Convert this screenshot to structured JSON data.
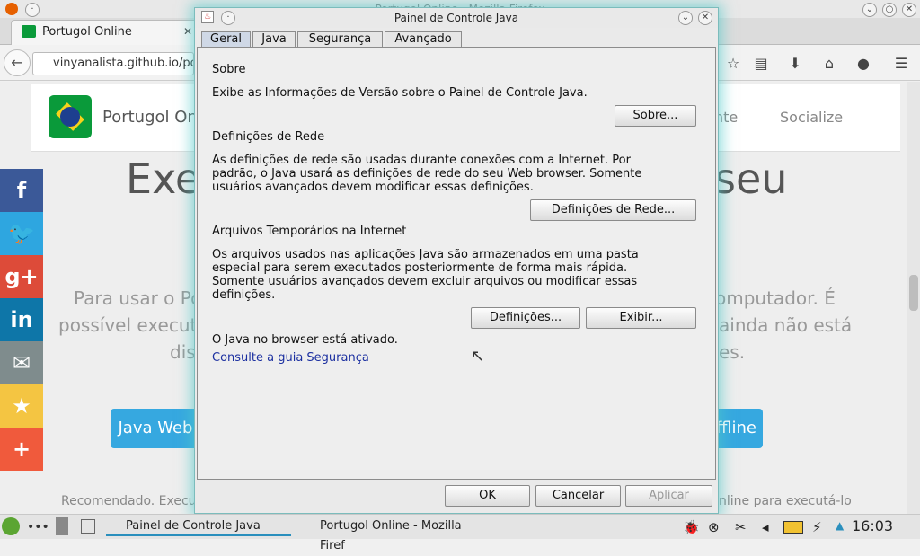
{
  "browser": {
    "window_title": "Portugol Online - Mozilla Firefox",
    "tab_title": "Portugol Online",
    "url": "vinyanalista.github.io/por"
  },
  "site": {
    "title": "Portugol Onli",
    "nav_right": "nte",
    "socialize": "Socialize",
    "hero_left": "Exe",
    "hero_right": "seu",
    "para_l1": "Para usar o Po",
    "para_l2": "possível execut",
    "para_l3": "dis",
    "para_r1": "omputador. É",
    "para_r2": "ainda não está",
    "para_r3": "es.",
    "btn_left": "Java Web",
    "btn_right": "ffline",
    "footnote_left": "Recomendado. Executa",
    "footnote_right": "nline para executá-lo"
  },
  "social": [
    {
      "icon": "f",
      "name": "facebook",
      "color": "#3b5998"
    },
    {
      "icon": "🐦",
      "name": "twitter",
      "color": "#2ea6e0"
    },
    {
      "icon": "g+",
      "name": "google-plus",
      "color": "#dd4b39"
    },
    {
      "icon": "in",
      "name": "linkedin",
      "color": "#0e76a8"
    },
    {
      "icon": "✉",
      "name": "email",
      "color": "#7f8c8d"
    },
    {
      "icon": "★",
      "name": "favorite",
      "color": "#f4c542"
    },
    {
      "icon": "+",
      "name": "more",
      "color": "#f05a3c"
    }
  ],
  "dialog": {
    "title": "Painel de Controle Java",
    "tabs": [
      "Geral",
      "Java",
      "Segurança",
      "Avançado"
    ],
    "sobre": {
      "heading": "Sobre",
      "text": "Exibe as Informações de Versão sobre o Painel de Controle Java.",
      "button": "Sobre..."
    },
    "rede": {
      "heading": "Definições de Rede",
      "line1": "As definições de rede são usadas durante conexões com a Internet. Por",
      "line2": "padrão, o Java usará as definições de rede do seu Web browser. Somente",
      "line3": "usuários avançados devem modificar essas definições.",
      "button": "Definições de Rede..."
    },
    "temp": {
      "heading": "Arquivos Temporários na Internet",
      "line1": "Os arquivos usados nas aplicações Java são armazenados em uma pasta",
      "line2": "especial para serem executados posteriormente de forma mais rápida.",
      "line3": "Somente usuários avançados devem excluir arquivos ou modificar essas",
      "line4": "definições.",
      "btn_settings": "Definições...",
      "btn_view": "Exibir..."
    },
    "status": "O Java no browser está ativado.",
    "link": "Consulte a guia Segurança",
    "ok": "OK",
    "cancel": "Cancelar",
    "apply": "Aplicar"
  },
  "taskbar": {
    "task1": "Painel de Controle Java",
    "task2": "Portugol Online - Mozilla Firef",
    "clock": "16:03"
  }
}
